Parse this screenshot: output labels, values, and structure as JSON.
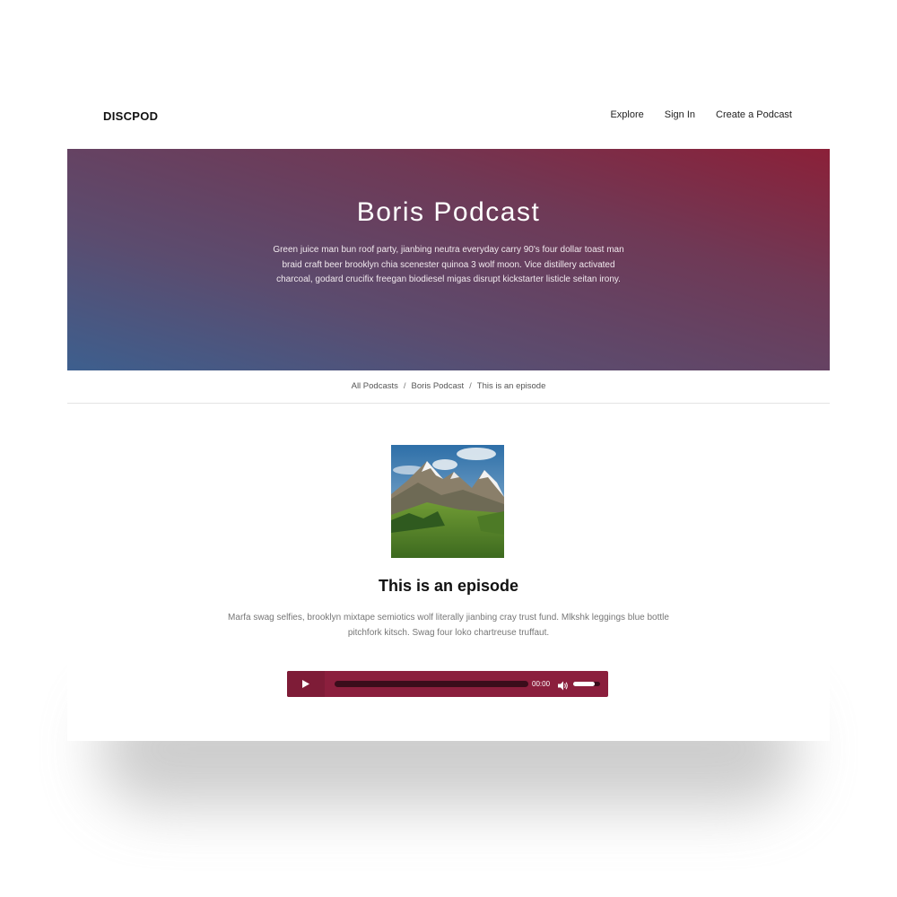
{
  "nav": {
    "logo": "DISCPOD",
    "links": [
      "Explore",
      "Sign In",
      "Create a Podcast"
    ]
  },
  "hero": {
    "title": "Boris Podcast",
    "description": "Green juice man bun roof party, jianbing neutra everyday carry 90's four dollar toast man braid craft beer brooklyn chia scenester quinoa 3 wolf moon. Vice distillery activated charcoal, godard crucifix freegan biodiesel migas disrupt kickstarter listicle seitan irony.",
    "gradient_colors": [
      "#3d5f8e",
      "#6f3956",
      "#8b2038"
    ]
  },
  "breadcrumb": {
    "items": [
      "All Podcasts",
      "Boris Podcast",
      "This is an episode"
    ],
    "separator": "/"
  },
  "episode": {
    "cover_icon": "mountain-landscape-image",
    "title": "This is an episode",
    "description": "Marfa swag selfies, brooklyn mixtape semiotics wolf literally jianbing cray trust fund. Mlkshk leggings blue bottle pitchfork kitsch. Swag four loko chartreuse truffaut."
  },
  "player": {
    "time": "00:00",
    "progress": 0,
    "volume": 0.8,
    "accent_color": "#8b1f3d",
    "play_icon": "play-icon",
    "volume_icon": "volume-icon"
  }
}
